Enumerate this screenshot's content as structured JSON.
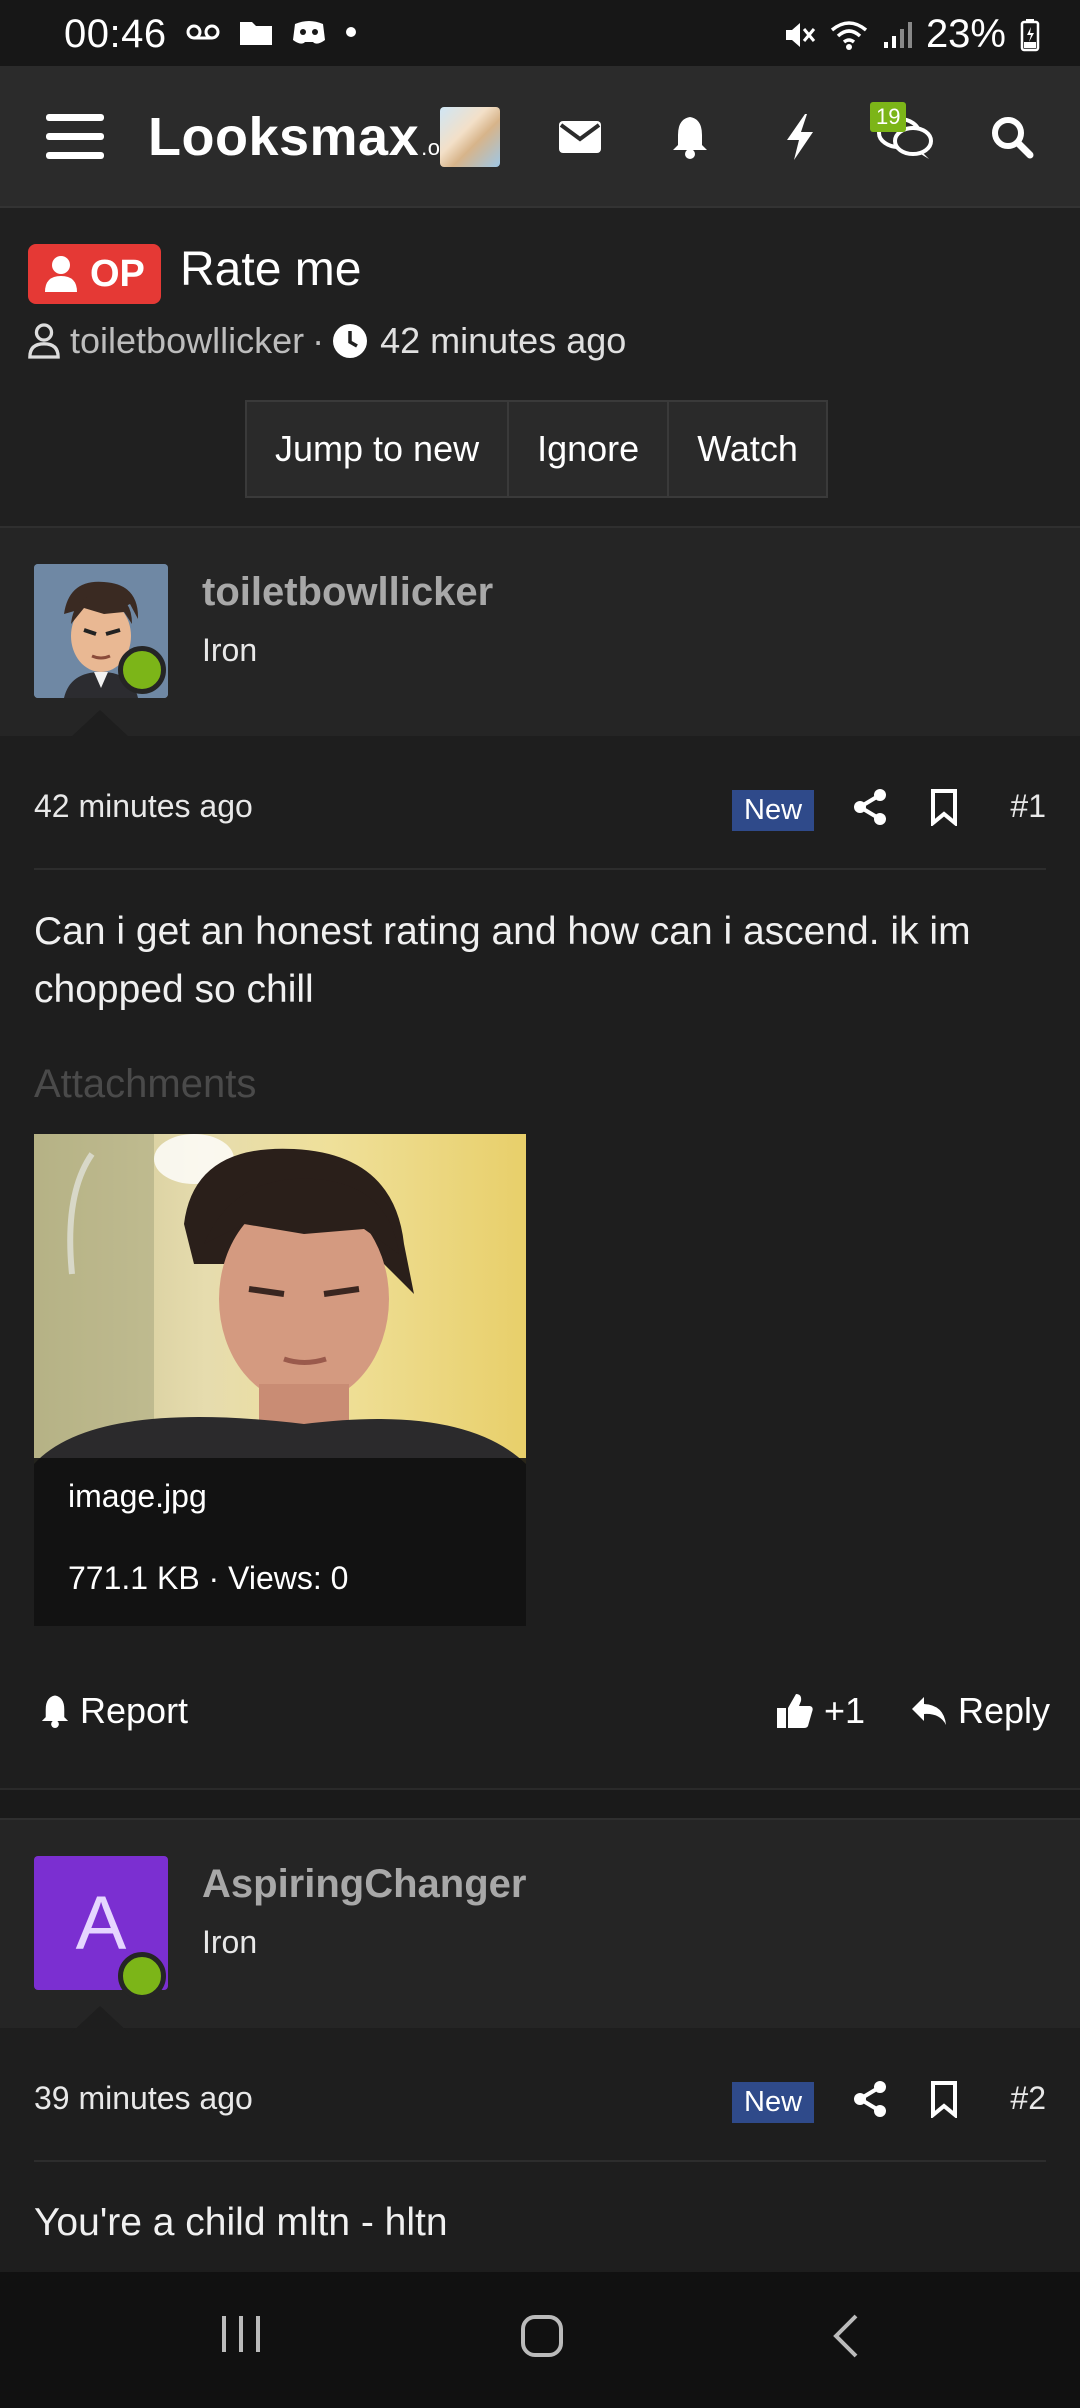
{
  "status_bar": {
    "time": "00:46",
    "battery": "23%"
  },
  "navbar": {
    "logo_main": "Looksmax",
    "logo_suffix": ".org",
    "chat_badge": "19",
    "icons": [
      "menu-icon",
      "avatar",
      "mail-icon",
      "bell-icon",
      "bolt-icon",
      "chat-icon",
      "search-icon"
    ]
  },
  "thread": {
    "op_label": "OP",
    "title": "Rate me",
    "author": "toiletbowllicker",
    "separator": "·",
    "posted": "42 minutes ago",
    "buttons": {
      "jump": "Jump to new",
      "ignore": "Ignore",
      "watch": "Watch"
    }
  },
  "posts": [
    {
      "username": "toiletbowllicker",
      "rank": "Iron",
      "when": "42 minutes ago",
      "new_label": "New",
      "number": "#1",
      "text": "Can i get an honest rating and how can i ascend. ik im chopped so chill",
      "attachments_label": "Attachments",
      "attachment": {
        "filename": "image.jpg",
        "info": "771.1 KB · Views: 0"
      },
      "actions": {
        "report": "Report",
        "likes": "+1",
        "reply": "Reply"
      }
    },
    {
      "username": "AspiringChanger",
      "rank": "Iron",
      "avatar_letter": "A",
      "avatar_color": "#7b2fd1",
      "when": "39 minutes ago",
      "new_label": "New",
      "number": "#2",
      "text": "You're a child mltn - hltn"
    }
  ],
  "colors": {
    "accent_red": "#e53935",
    "online_green": "#7cb518",
    "new_badge_blue": "#2f4a8a"
  }
}
